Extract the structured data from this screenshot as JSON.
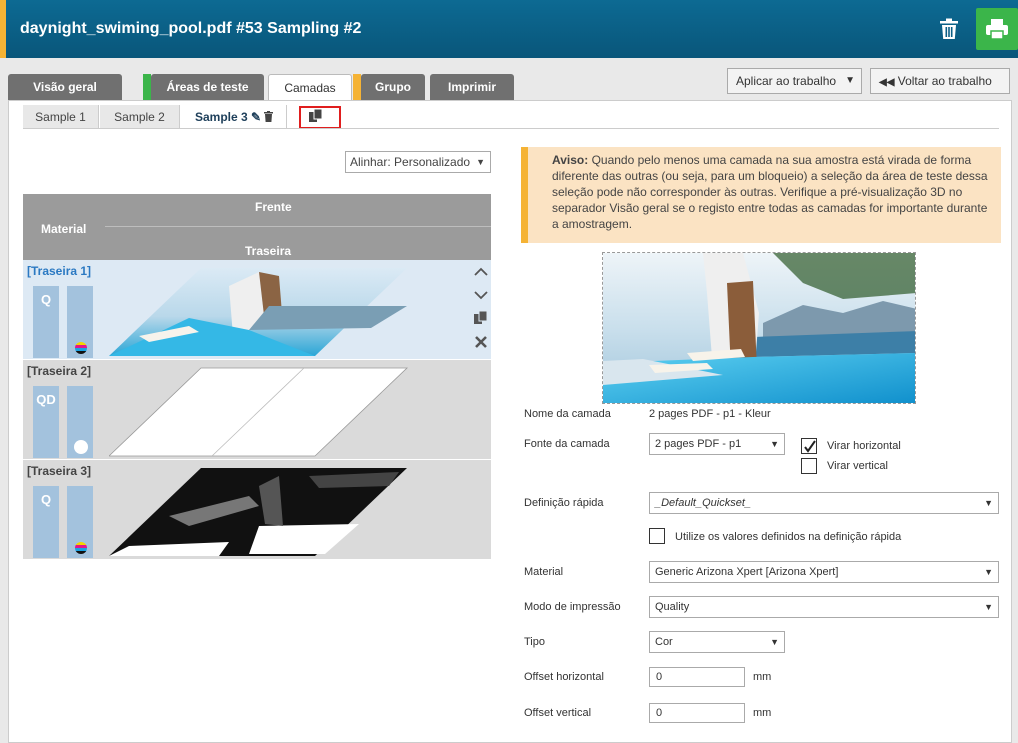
{
  "header": {
    "title": "daynight_swiming_pool.pdf #53 Sampling #2",
    "trash_icon": "trash-icon",
    "print_icon": "printer-icon"
  },
  "tabs": [
    {
      "label": "Visão geral",
      "stripe": ""
    },
    {
      "label": "Áreas de teste",
      "stripe": "#3bb54a"
    },
    {
      "label": "Camadas",
      "stripe": "#f5b335"
    },
    {
      "label": "Grupo",
      "stripe": "#f5b335"
    },
    {
      "label": "Imprimir",
      "stripe": ""
    }
  ],
  "actions": {
    "apply_label": "Aplicar ao trabalho",
    "back_label": "Voltar ao trabalho"
  },
  "subtabs": [
    {
      "label": "Sample 1"
    },
    {
      "label": "Sample 2"
    },
    {
      "label": "Sample 3"
    }
  ],
  "align": {
    "label": "Alinhar: Personalizado"
  },
  "layer_table": {
    "material_header": "Material",
    "front_header": "Frente",
    "back_header": "Traseira",
    "rows": [
      {
        "name": "[Traseira 1]",
        "mode": "Q",
        "colors": "cmyk"
      },
      {
        "name": "[Traseira 2]",
        "mode": "QD",
        "colors": "white"
      },
      {
        "name": "[Traseira 3]",
        "mode": "Q",
        "colors": "cmyk"
      }
    ]
  },
  "warning": {
    "bold": "Aviso:",
    "text": " Quando pelo menos uma camada na sua amostra está virada de forma diferente das outras (ou seja, para um bloqueio) a seleção da área de teste dessa seleção pode não corresponder às outras. Verifique a pré-visualização 3D no separador Visão geral se o registo entre todas as camadas for importante durante a amostragem."
  },
  "form": {
    "layer_name_label": "Nome da camada",
    "layer_name_value": "2 pages PDF - p1 - Kleur",
    "layer_source_label": "Fonte da camada",
    "layer_source_value": "2 pages PDF - p1",
    "flip_h_label": "Virar horizontal",
    "flip_h_checked": true,
    "flip_v_label": "Virar vertical",
    "flip_v_checked": false,
    "quickset_label": "Definição rápida",
    "quickset_value": "_Default_Quickset_",
    "use_quickset_label": "Utilize os valores definidos na definição rápida",
    "material_label": "Material",
    "material_value": "Generic Arizona Xpert [Arizona Xpert]",
    "print_mode_label": "Modo de impressão",
    "print_mode_value": "Quality",
    "type_label": "Tipo",
    "type_value": "Cor",
    "offset_h_label": "Offset horizontal",
    "offset_h_value": "0",
    "offset_v_label": "Offset vertical",
    "offset_v_value": "0",
    "unit": "mm"
  },
  "colors": {
    "header_bg": "#0d6a93",
    "accent_orange": "#f5b335",
    "accent_green": "#3bb54a",
    "selected_row": "#dde9f4",
    "highlight": "#e01e1e"
  }
}
